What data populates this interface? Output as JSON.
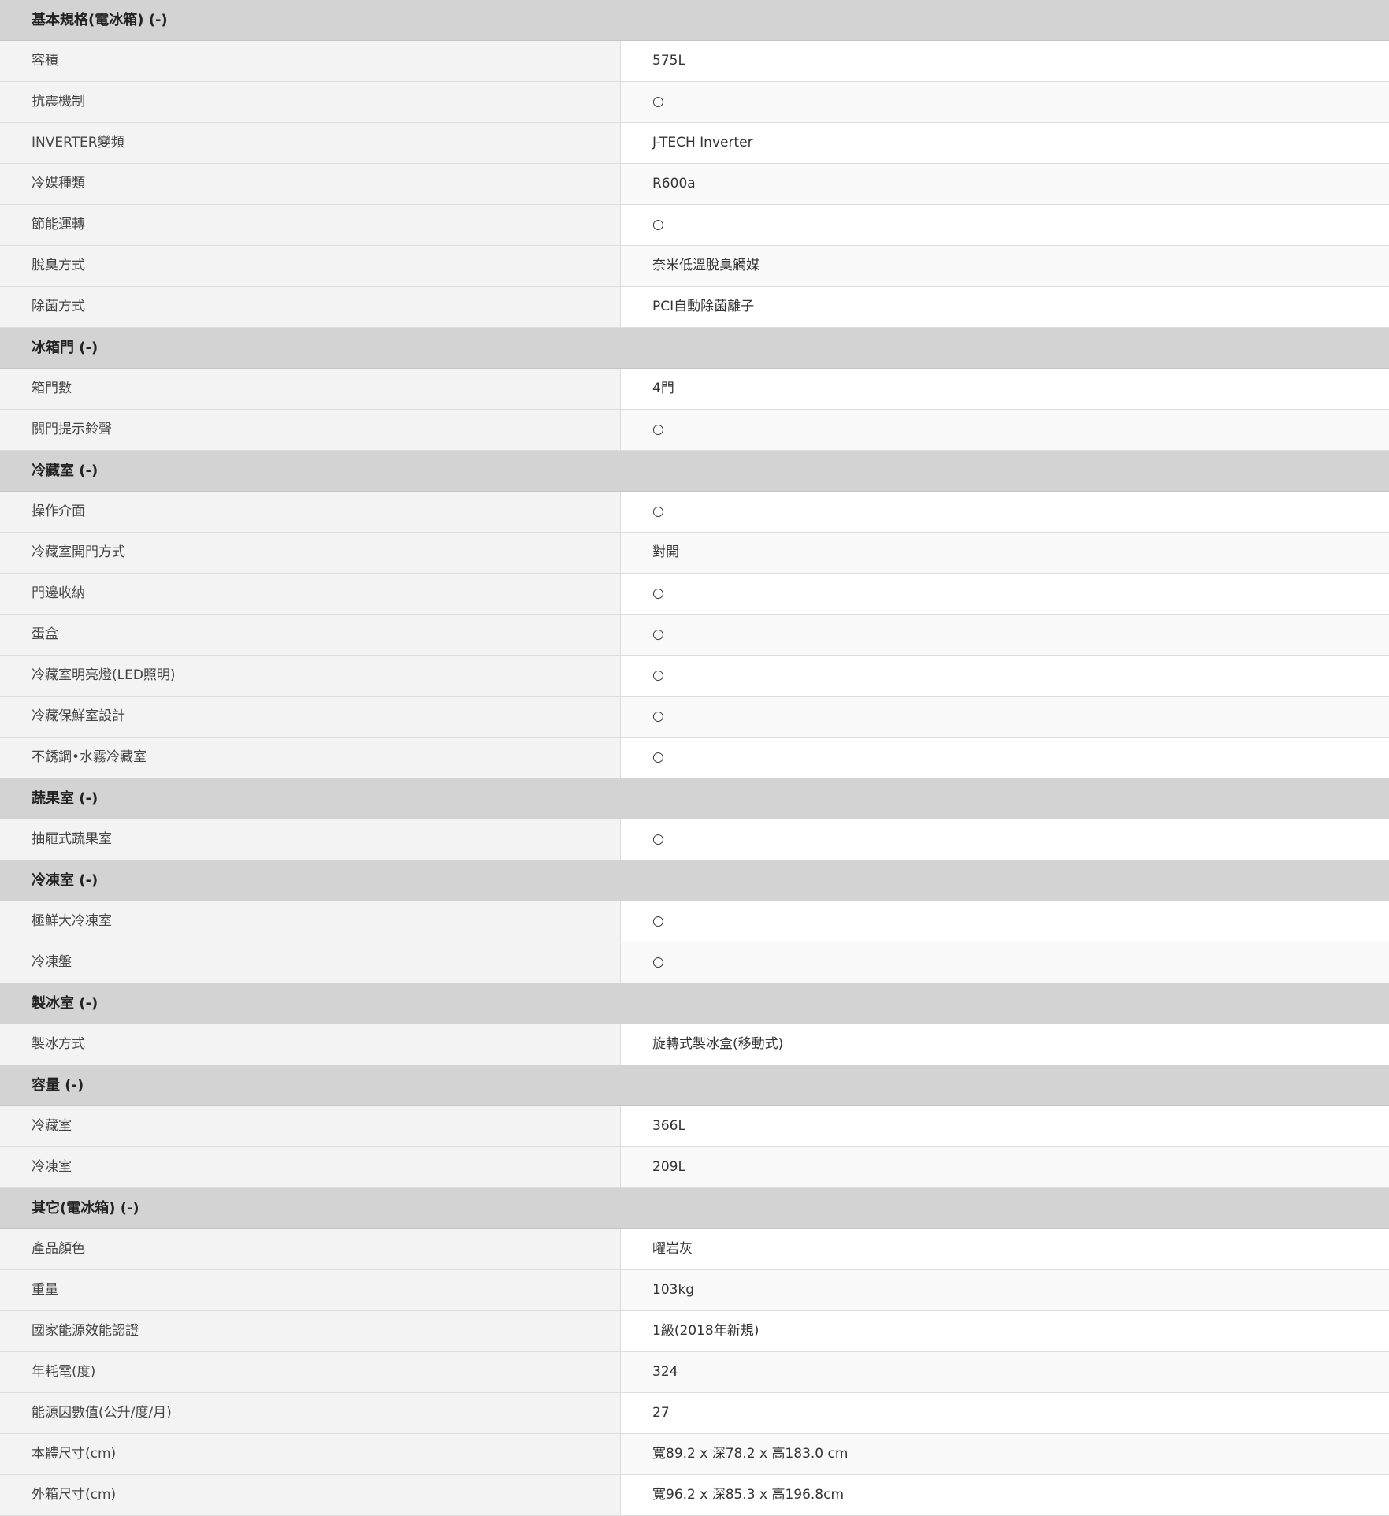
{
  "sections": [
    {
      "title": "基本規格(電冰箱) (-)",
      "rows": [
        {
          "label": "容積",
          "value": "575L"
        },
        {
          "label": "抗震機制",
          "value": "○"
        },
        {
          "label": "INVERTER變頻",
          "value": "J-TECH Inverter"
        },
        {
          "label": "冷媒種類",
          "value": "R600a"
        },
        {
          "label": "節能運轉",
          "value": "○"
        },
        {
          "label": "脫臭方式",
          "value": "奈米低溫脫臭觸媒"
        },
        {
          "label": "除菌方式",
          "value": "PCI自動除菌離子"
        }
      ]
    },
    {
      "title": "冰箱門 (-)",
      "rows": [
        {
          "label": "箱門數",
          "value": "4門"
        },
        {
          "label": "關門提示鈴聲",
          "value": "○"
        }
      ]
    },
    {
      "title": "冷藏室 (-)",
      "rows": [
        {
          "label": "操作介面",
          "value": "○"
        },
        {
          "label": "冷藏室開門方式",
          "value": "對開"
        },
        {
          "label": "門邊收納",
          "value": "○"
        },
        {
          "label": "蛋盒",
          "value": "○"
        },
        {
          "label": "冷藏室明亮燈(LED照明)",
          "value": "○"
        },
        {
          "label": "冷藏保鮮室設計",
          "value": "○"
        },
        {
          "label": "不銹鋼•水霧冷藏室",
          "value": "○"
        }
      ]
    },
    {
      "title": "蔬果室 (-)",
      "rows": [
        {
          "label": "抽屜式蔬果室",
          "value": "○"
        }
      ]
    },
    {
      "title": "冷凍室 (-)",
      "rows": [
        {
          "label": "極鮮大冷凍室",
          "value": "○"
        },
        {
          "label": "冷凍盤",
          "value": "○"
        }
      ]
    },
    {
      "title": "製冰室 (-)",
      "rows": [
        {
          "label": "製冰方式",
          "value": "旋轉式製冰盒(移動式)"
        }
      ]
    },
    {
      "title": "容量 (-)",
      "rows": [
        {
          "label": "冷藏室",
          "value": "366L"
        },
        {
          "label": "冷凍室",
          "value": "209L"
        }
      ]
    },
    {
      "title": "其它(電冰箱) (-)",
      "rows": [
        {
          "label": "產品顏色",
          "value": "曜岩灰"
        },
        {
          "label": "重量",
          "value": "103kg"
        },
        {
          "label": "國家能源效能認證",
          "value": "1級(2018年新規)"
        },
        {
          "label": "年耗電(度)",
          "value": "324"
        },
        {
          "label": "能源因數值(公升/度/月)",
          "value": "27"
        },
        {
          "label": "本體尺寸(cm)",
          "value": "寬89.2 x 深78.2 x 高183.0 cm"
        },
        {
          "label": "外箱尺寸(cm)",
          "value": "寬96.2 x 深85.3 x 高196.8cm"
        }
      ]
    }
  ]
}
